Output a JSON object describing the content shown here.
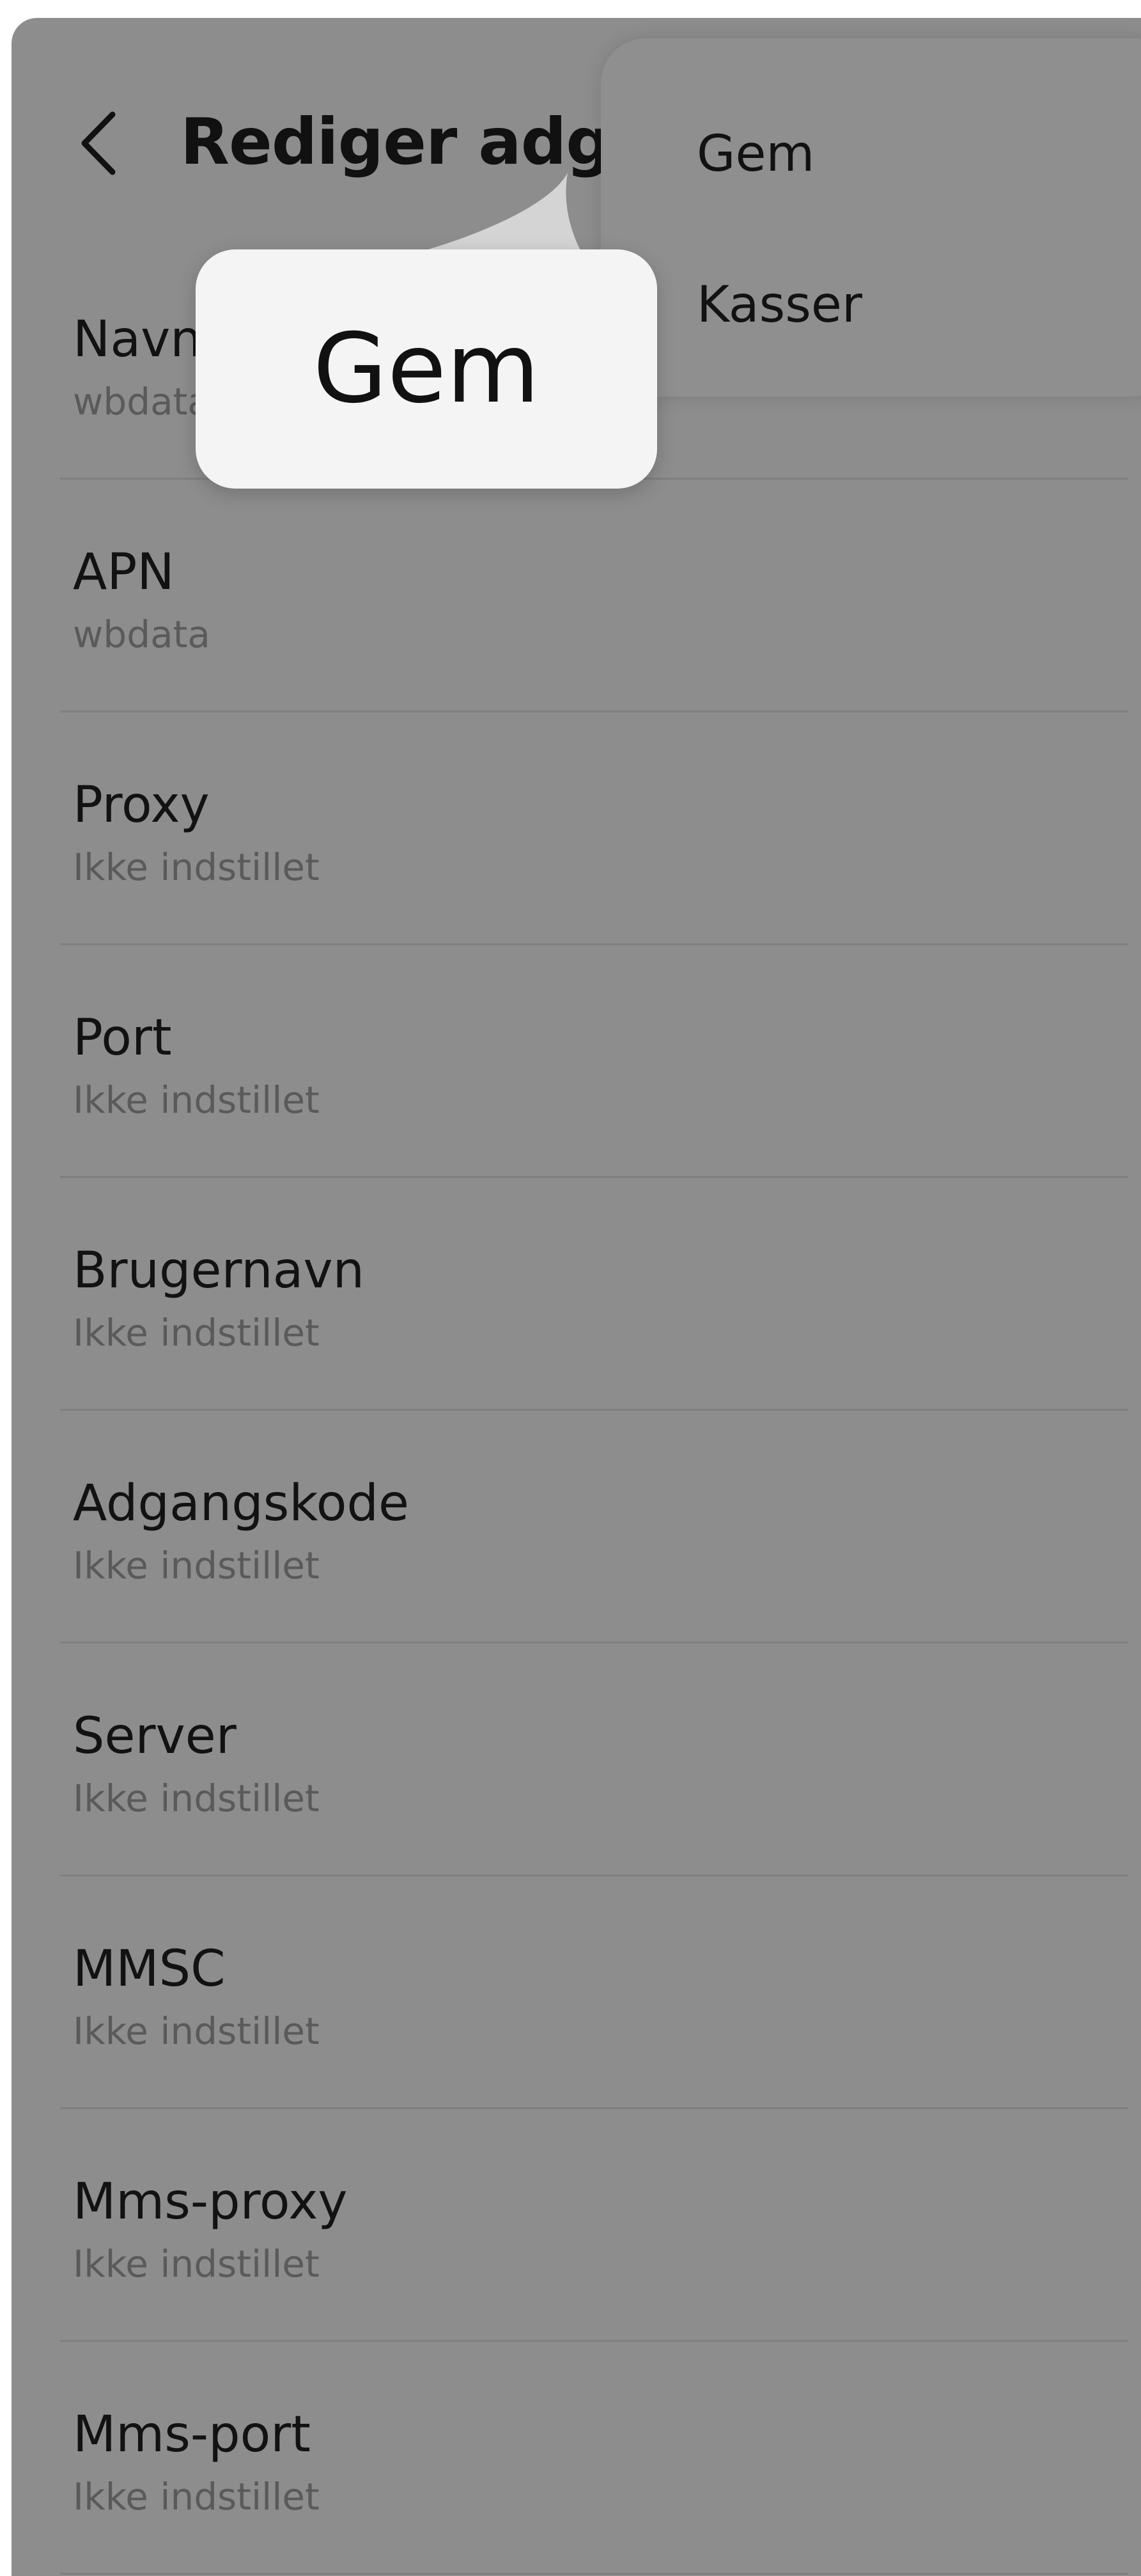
{
  "header": {
    "title": "Rediger adga",
    "back_icon": "chevron-left-icon"
  },
  "fields": [
    {
      "label": "Navn",
      "value": "wbdata"
    },
    {
      "label": "APN",
      "value": "wbdata"
    },
    {
      "label": "Proxy",
      "value": "Ikke indstillet"
    },
    {
      "label": "Port",
      "value": "Ikke indstillet"
    },
    {
      "label": "Brugernavn",
      "value": "Ikke indstillet"
    },
    {
      "label": "Adgangskode",
      "value": "Ikke indstillet"
    },
    {
      "label": "Server",
      "value": "Ikke indstillet"
    },
    {
      "label": "MMSC",
      "value": "Ikke indstillet"
    },
    {
      "label": "Mms-proxy",
      "value": "Ikke indstillet"
    },
    {
      "label": "Mms-port",
      "value": "Ikke indstillet"
    }
  ],
  "menu": {
    "items": [
      {
        "label": "Gem"
      },
      {
        "label": "Kasser"
      }
    ]
  },
  "callout": {
    "label": "Gem"
  },
  "colors": {
    "overlay": "#8d8d8e",
    "menu_background": "#8f8f90",
    "callout_background": "#f4f4f5",
    "primary_text": "#121212",
    "secondary_text": "#5a5a5a"
  }
}
